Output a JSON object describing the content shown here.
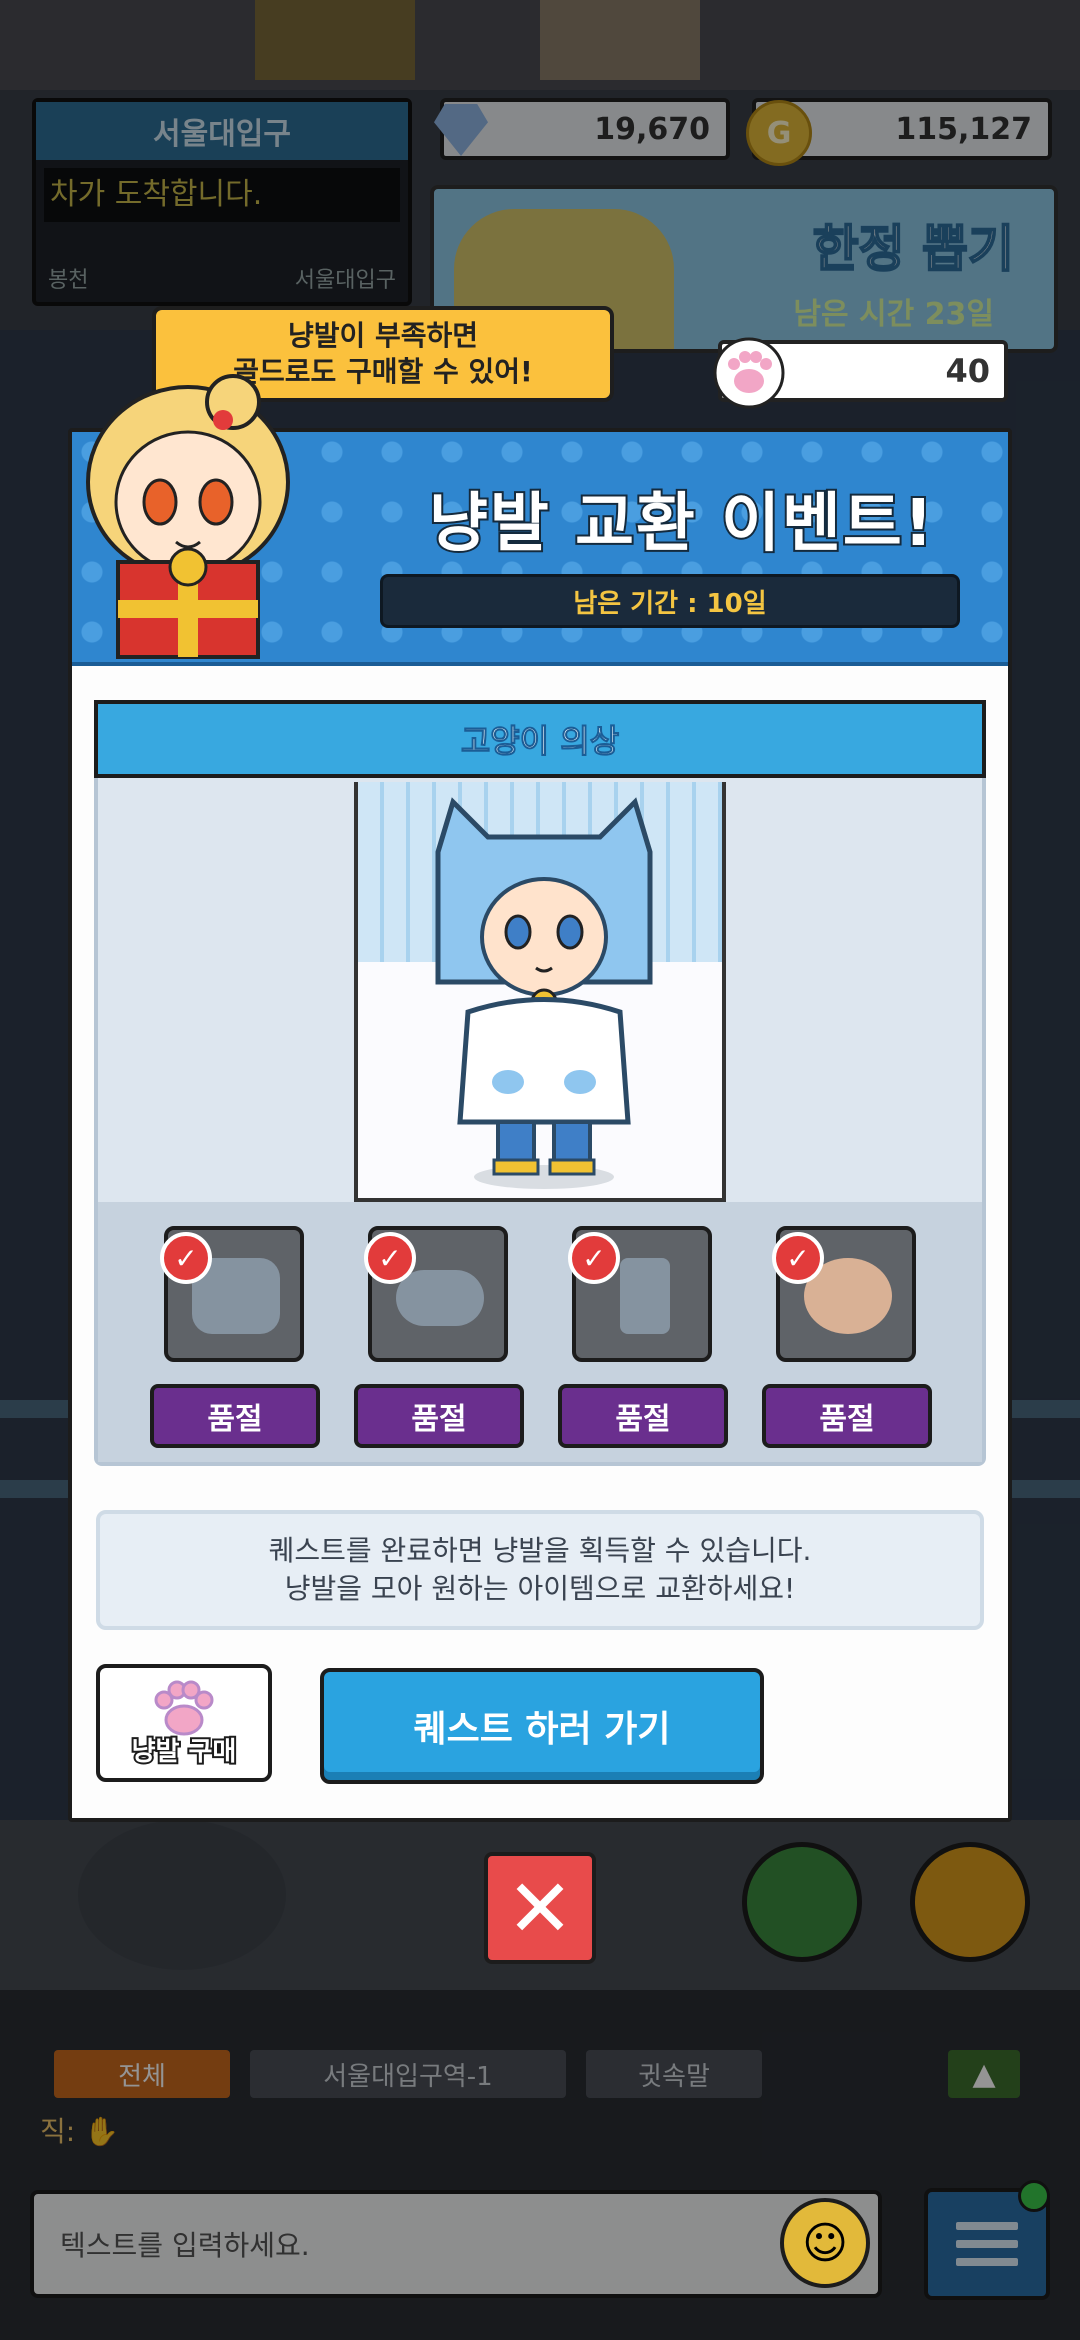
{
  "hud": {
    "station_name": "서울대입구",
    "ticker_text": "차가 도착합니다.",
    "prev_station": "봉천",
    "next_station": "서울대입구",
    "gems": "19,670",
    "gold": "115,127",
    "gold_icon": "G",
    "gacha_title": "한정 뽑기",
    "gacha_remaining": "남은 시간 23일",
    "paw_count": "40"
  },
  "speech_bubble": {
    "line1": "냥발이 부족하면",
    "line2": "골드로도 구매할 수 있어!"
  },
  "modal": {
    "title": "냥발 교환 이벤트!",
    "period": "남은 기간 : 10일",
    "section_title": "고양이 의상",
    "items": [
      {
        "status": "품절",
        "checked": true,
        "icon": "cat-hood-icon"
      },
      {
        "status": "품절",
        "checked": true,
        "icon": "cat-tail-icon"
      },
      {
        "status": "품절",
        "checked": true,
        "icon": "boots-icon"
      },
      {
        "status": "품절",
        "checked": true,
        "icon": "face-icon"
      }
    ],
    "info_line1": "퀘스트를 완료하면 냥발을 획득할 수 있습니다.",
    "info_line2": "냥발을 모아 원하는 아이템으로 교환하세요!",
    "buy_paw_label": "냥발 구매",
    "quest_button_label": "퀘스트 하러 가기",
    "close_symbol": "✕"
  },
  "chat": {
    "tabs": [
      "전체",
      "서울대입구역-1",
      "귓속말"
    ],
    "collapse_symbol": "▲",
    "line_prefix": "직:",
    "input_placeholder": "텍스트를 입력하세요."
  },
  "colors": {
    "header_blue": "#2f86cf",
    "section_blue": "#38a8e0",
    "soldout_purple": "#6a2f8e",
    "bubble_yellow": "#fbc13d",
    "close_red": "#e84b4b"
  }
}
